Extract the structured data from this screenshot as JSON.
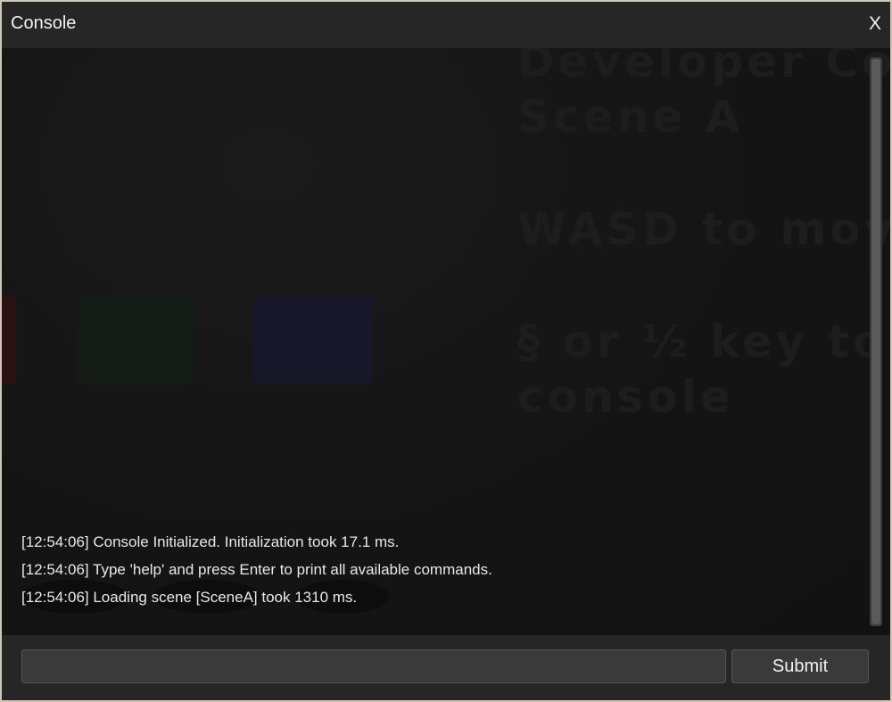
{
  "window": {
    "title": "Console",
    "close_label": "X"
  },
  "scene": {
    "title_line1": "Developer Con",
    "title_line2": "Scene A",
    "move_hint": "WASD to move",
    "console_hint_line1": "§ or ½ key to t",
    "console_hint_line2": "console"
  },
  "log": {
    "lines": [
      "[12:54:06] Console Initialized. Initialization took 17.1 ms.",
      "[12:54:06] Type 'help' and press Enter to print all available commands.",
      "[12:54:06] Loading scene [SceneA] took 1310 ms."
    ]
  },
  "input": {
    "value": "",
    "placeholder": ""
  },
  "submit_label": "Submit"
}
